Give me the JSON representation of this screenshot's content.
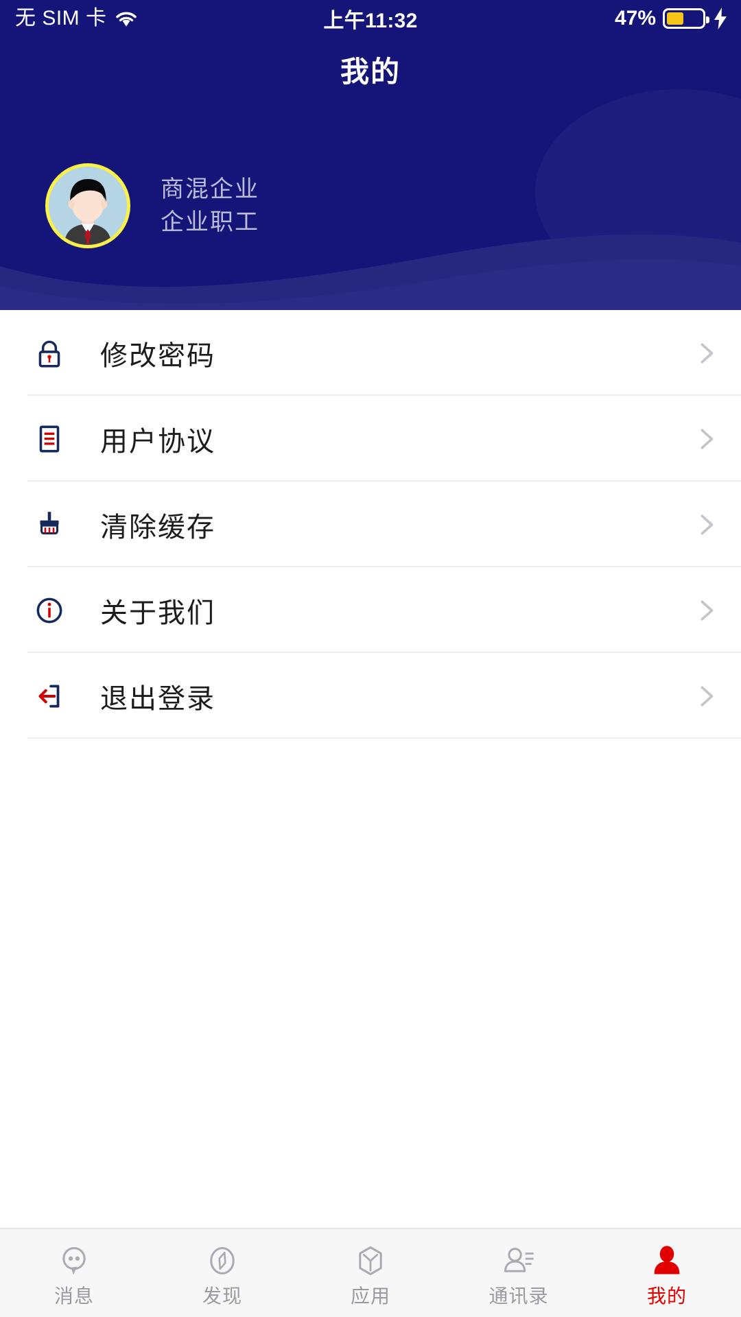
{
  "status_bar": {
    "carrier": "无 SIM 卡",
    "wifi_icon": "wifi-icon",
    "time": "上午11:32",
    "battery_percent_label": "47%",
    "battery_level": 47,
    "battery_icon": "battery-icon",
    "charging_icon": "lightning-bolt-icon"
  },
  "nav": {
    "title": "我的"
  },
  "profile": {
    "avatar_icon": "user-avatar",
    "company": "商混企业",
    "role": "企业职工"
  },
  "menu": {
    "items": [
      {
        "label": "修改密码",
        "icon": "lock-icon",
        "chevron": "chevron-right-icon"
      },
      {
        "label": "用户协议",
        "icon": "document-icon",
        "chevron": "chevron-right-icon"
      },
      {
        "label": "清除缓存",
        "icon": "broom-icon",
        "chevron": "chevron-right-icon"
      },
      {
        "label": "关于我们",
        "icon": "info-circle-icon",
        "chevron": "chevron-right-icon"
      },
      {
        "label": "退出登录",
        "icon": "logout-icon",
        "chevron": "chevron-right-icon"
      }
    ]
  },
  "tabbar": {
    "items": [
      {
        "label": "消息",
        "icon": "chat-bubble-icon",
        "active": false
      },
      {
        "label": "发现",
        "icon": "compass-icon",
        "active": false
      },
      {
        "label": "应用",
        "icon": "cube-icon",
        "active": false
      },
      {
        "label": "通讯录",
        "icon": "contacts-icon",
        "active": false
      },
      {
        "label": "我的",
        "icon": "person-icon",
        "active": true
      }
    ]
  },
  "colors": {
    "header_navy": "#151579",
    "header_wave": "#272780",
    "accent_red": "#e00000",
    "icon_navy": "#16295c",
    "avatar_ring": "#f7f14a",
    "avatar_bg": "#b5d4e4",
    "battery_yellow": "#f5c518",
    "tab_inactive": "#9a9aa2",
    "divider": "#eeeeee"
  }
}
